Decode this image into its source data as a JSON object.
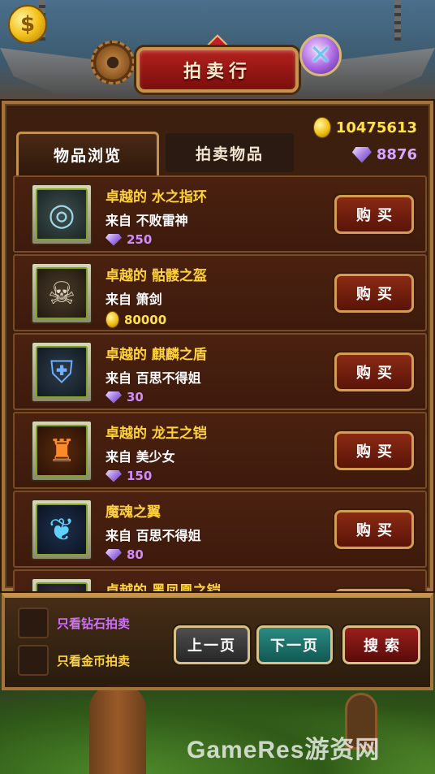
{
  "header": {
    "title": "拍卖行",
    "coin_icon": "coin-icon",
    "close_icon": "close-icon"
  },
  "tabs": [
    {
      "label": "物品浏览",
      "active": true
    },
    {
      "label": "拍卖物品",
      "active": false
    }
  ],
  "currency": {
    "gold": "10475613",
    "diamond": "8876"
  },
  "items": [
    {
      "name": "卓越的 水之指环",
      "from": "来自 不败雷神",
      "price": "250",
      "currency": "diamond",
      "icon": "ring-icon",
      "glyph": "◎",
      "buy_label": "购买"
    },
    {
      "name": "卓越的 骷髅之盔",
      "from": "来自 箫剑",
      "price": "80000",
      "currency": "gold",
      "icon": "skull-helmet-icon",
      "glyph": "☠",
      "buy_label": "购买"
    },
    {
      "name": "卓越的 麒麟之盾",
      "from": "来自 百思不得姐",
      "price": "30",
      "currency": "diamond",
      "icon": "shield-icon",
      "glyph": "⛨",
      "buy_label": "购买"
    },
    {
      "name": "卓越的 龙王之铠",
      "from": "来自 美少女",
      "price": "150",
      "currency": "diamond",
      "icon": "armor-icon",
      "glyph": "♜",
      "buy_label": "购买"
    },
    {
      "name": "魔魂之翼",
      "from": "来自 百思不得姐",
      "price": "80",
      "currency": "diamond",
      "icon": "wings-icon",
      "glyph": "❦",
      "buy_label": "购买"
    },
    {
      "name": "卓越的 黑凤凰之铠",
      "from": "",
      "price": "",
      "currency": "diamond",
      "icon": "phoenix-armor-icon",
      "glyph": "✧",
      "buy_label": "购买"
    }
  ],
  "filters": {
    "diamond_only": "只看钻石拍卖",
    "gold_only": "只看金币拍卖"
  },
  "nav": {
    "prev": "上一页",
    "next": "下一页",
    "search": "搜索"
  },
  "watermark": "GameRes游资网"
}
